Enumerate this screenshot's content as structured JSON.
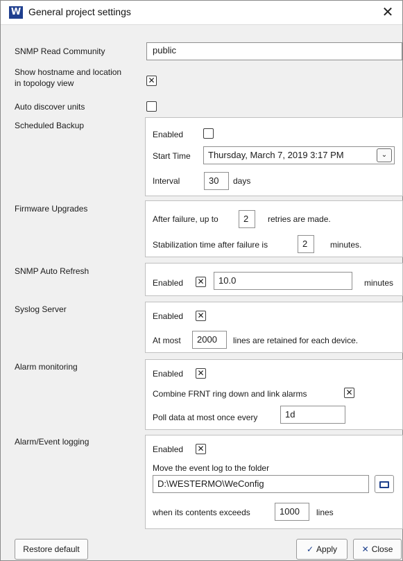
{
  "window": {
    "title": "General project settings",
    "app_icon": "W",
    "close_glyph": "✕"
  },
  "snmp_read": {
    "label": "SNMP Read Community",
    "value": "public"
  },
  "show_hostname": {
    "label_line1": "Show hostname and location",
    "label_line2": "in topology view",
    "checked_mark": "✕"
  },
  "auto_discover": {
    "label": "Auto discover units",
    "checked_mark": ""
  },
  "scheduled_backup": {
    "label": "Scheduled Backup",
    "enabled_label": "Enabled",
    "enabled_mark": "",
    "start_label": "Start Time",
    "start_value": "Thursday, March 7, 2019 3:17 PM",
    "interval_label": "Interval",
    "interval_value": "30",
    "interval_unit": "days"
  },
  "firmware": {
    "label": "Firmware Upgrades",
    "line1_pre": "After failure, up to",
    "retries": "2",
    "line1_post": "retries are made.",
    "line2_pre": "Stabilization time after failure is",
    "minutes": "2",
    "line2_post": "minutes."
  },
  "snmp_refresh": {
    "label": "SNMP Auto Refresh",
    "enabled_label": "Enabled",
    "enabled_mark": "✕",
    "value": "10.0",
    "unit": "minutes"
  },
  "syslog": {
    "label": "Syslog Server",
    "enabled_label": "Enabled",
    "enabled_mark": "✕",
    "line_pre": "At most",
    "lines": "2000",
    "line_post": "lines are retained for each device."
  },
  "alarm": {
    "label": "Alarm monitoring",
    "enabled_label": "Enabled",
    "enabled_mark": "✕",
    "combine_label": "Combine FRNT ring down and link alarms",
    "combine_mark": "✕",
    "poll_label": "Poll data at most once every",
    "poll_value": "1d"
  },
  "event_logging": {
    "label": "Alarm/Event logging",
    "enabled_label": "Enabled",
    "enabled_mark": "✕",
    "move_label": "Move the event log to the folder",
    "folder_value": "D:\\WESTERMO\\WeConfig",
    "exceeds_pre": "when its contents exceeds",
    "exceeds_value": "1000",
    "exceeds_post": "lines"
  },
  "footer": {
    "restore_label": "Restore default",
    "apply_label": "Apply",
    "close_label": "Close",
    "apply_glyph": "✓",
    "close_glyph": "✕"
  },
  "colors": {
    "accent": "#1c3f8c",
    "background": "#f0f0f0"
  }
}
